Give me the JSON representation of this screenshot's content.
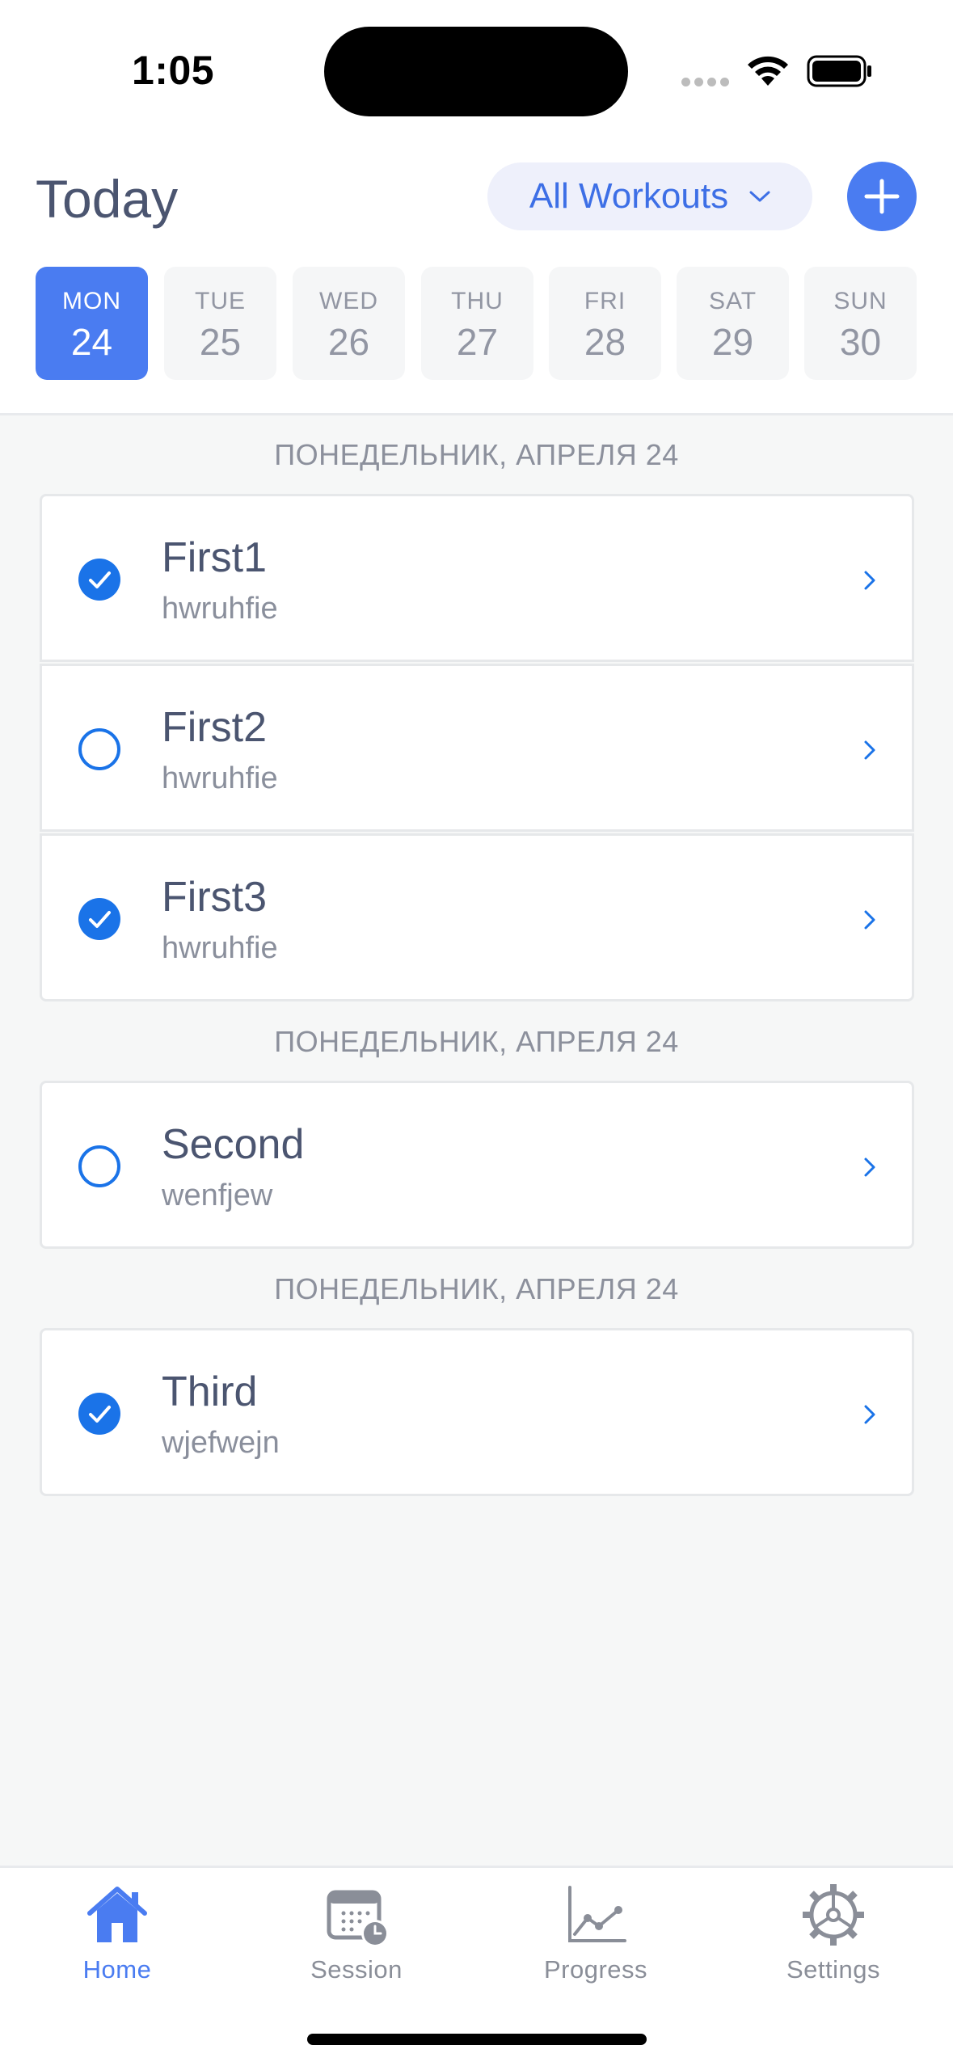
{
  "status_bar": {
    "time": "1:05"
  },
  "header": {
    "title": "Today",
    "filter_label": "All Workouts"
  },
  "week": [
    {
      "name": "MON",
      "date": "24",
      "selected": true
    },
    {
      "name": "TUE",
      "date": "25",
      "selected": false
    },
    {
      "name": "WED",
      "date": "26",
      "selected": false
    },
    {
      "name": "THU",
      "date": "27",
      "selected": false
    },
    {
      "name": "FRI",
      "date": "28",
      "selected": false
    },
    {
      "name": "SAT",
      "date": "29",
      "selected": false
    },
    {
      "name": "SUN",
      "date": "30",
      "selected": false
    }
  ],
  "sections": [
    {
      "header": "ПОНЕДЕЛЬНИК, АПРЕЛЯ 24",
      "items": [
        {
          "title": "First1",
          "subtitle": "hwruhfie",
          "done": true
        },
        {
          "title": "First2",
          "subtitle": "hwruhfie",
          "done": false
        },
        {
          "title": "First3",
          "subtitle": "hwruhfie",
          "done": true
        }
      ]
    },
    {
      "header": "ПОНЕДЕЛЬНИК, АПРЕЛЯ 24",
      "items": [
        {
          "title": "Second",
          "subtitle": "wenfjew",
          "done": false
        }
      ]
    },
    {
      "header": "ПОНЕДЕЛЬНИК, АПРЕЛЯ 24",
      "items": [
        {
          "title": "Third",
          "subtitle": "wjefwejn",
          "done": true
        }
      ]
    }
  ],
  "tabs": [
    {
      "label": "Home",
      "icon": "house-icon",
      "active": true
    },
    {
      "label": "Session",
      "icon": "calendar-clock-icon",
      "active": false
    },
    {
      "label": "Progress",
      "icon": "chart-line-icon",
      "active": false
    },
    {
      "label": "Settings",
      "icon": "gear-icon",
      "active": false
    }
  ],
  "colors": {
    "accent": "#4a7cf1",
    "check": "#1a73e8",
    "pill_bg": "#eef0fb",
    "tab_inactive": "#8a8e98"
  }
}
